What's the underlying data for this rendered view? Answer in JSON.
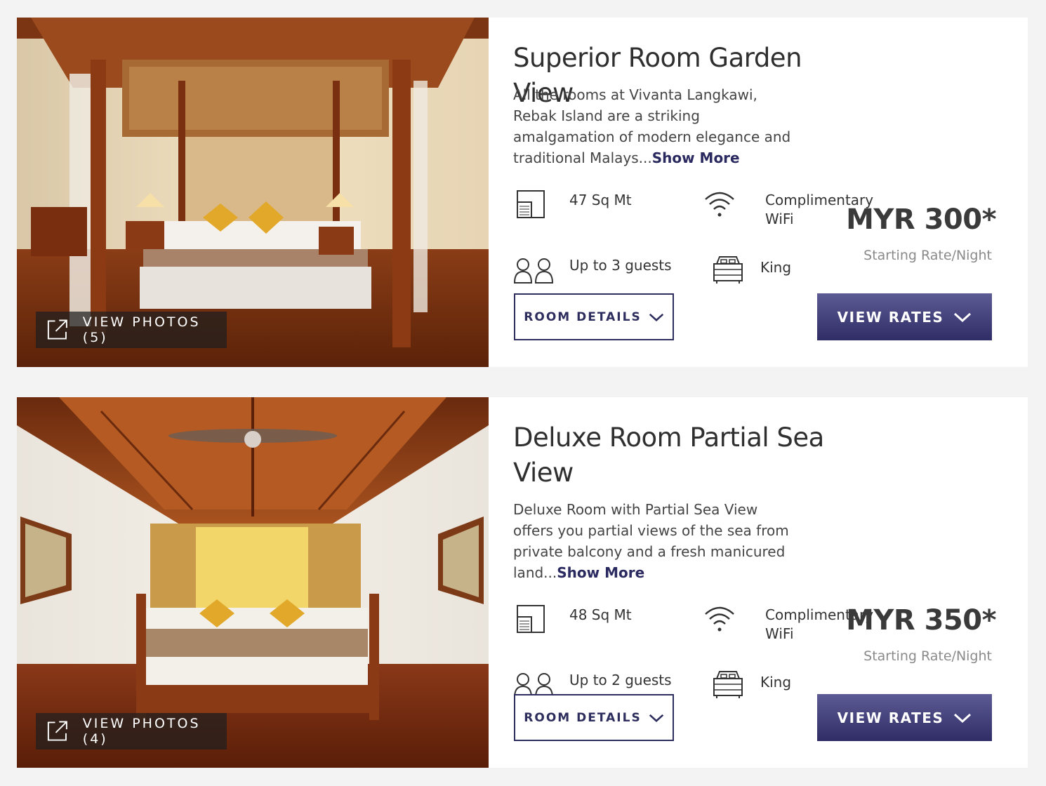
{
  "rooms": [
    {
      "title": "Superior Room Garden View",
      "description": "All the rooms at Vivanta Langkawi, Rebak Island are a striking amalgamation of modern elegance and traditional Malays...",
      "show_more": "Show More",
      "view_photos": "VIEW PHOTOS (5)",
      "area": "47 Sq Mt",
      "wifi": "Complimentary WiFi",
      "guests": "Up to 3 guests",
      "bed": "King",
      "price": "MYR 300*",
      "price_note": "Starting Rate/Night",
      "details_label": "ROOM DETAILS",
      "rates_label": "VIEW RATES"
    },
    {
      "title": "Deluxe Room Partial Sea View",
      "description": "Deluxe Room with Partial Sea View offers you partial views of the sea from private balcony and a fresh manicured land...",
      "show_more": "Show More",
      "view_photos": "VIEW PHOTOS (4)",
      "area": "48 Sq Mt",
      "wifi": "Complimentary WiFi",
      "guests": "Up to 2 guests",
      "bed": "King",
      "price": "MYR 350*",
      "price_note": "Starting Rate/Night",
      "details_label": "ROOM DETAILS",
      "rates_label": "VIEW RATES"
    }
  ],
  "colors": {
    "accent": "#2e2e5e",
    "button_gradient_top": "#5d5b94",
    "button_gradient_bottom": "#2f2c66",
    "page_bg": "#f3f3f3"
  },
  "icons": [
    "area-icon",
    "wifi-icon",
    "guests-icon",
    "bed-icon",
    "external-link-icon",
    "chevron-down-icon"
  ]
}
